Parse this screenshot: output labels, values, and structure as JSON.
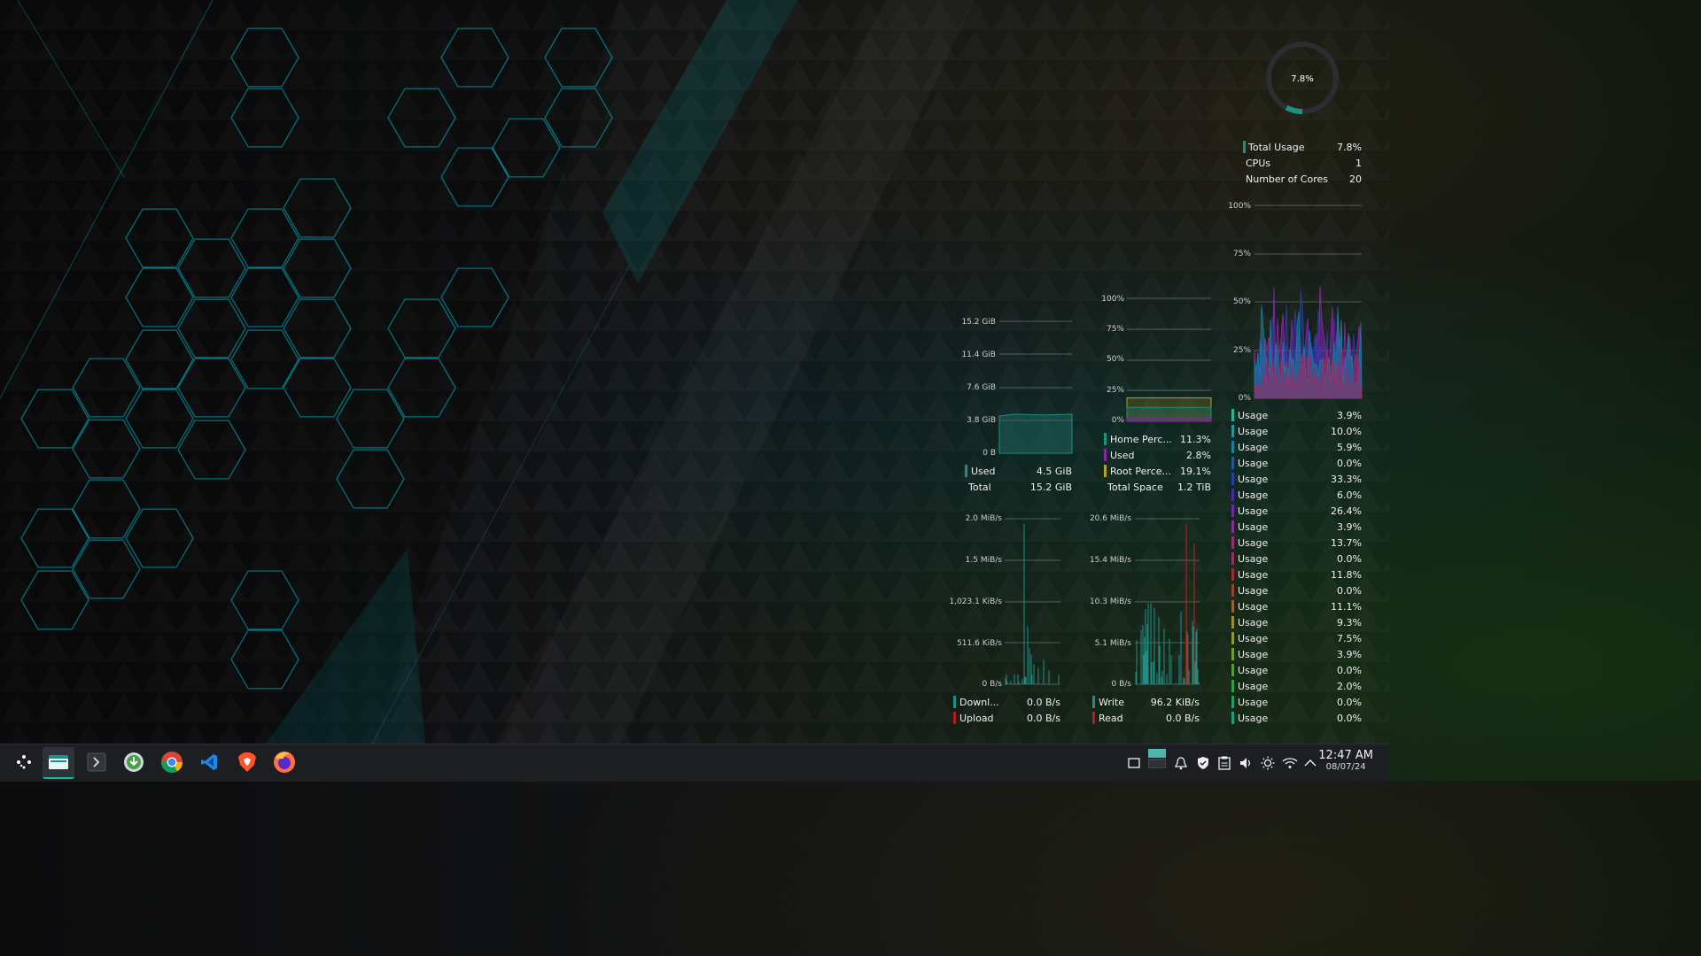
{
  "cpu_widget": {
    "gauge_value": "7.8%",
    "gauge_fraction": 0.078,
    "rows": [
      {
        "label": "Total Usage",
        "value": "7.8%"
      },
      {
        "label": "CPUs",
        "value": "1"
      },
      {
        "label": "Number of Cores",
        "value": "20"
      }
    ],
    "axis": [
      "100%",
      "75%",
      "50%",
      "25%",
      "0%"
    ]
  },
  "cores": {
    "label": "Usage",
    "values": [
      "3.9%",
      "10.0%",
      "5.9%",
      "0.0%",
      "33.3%",
      "6.0%",
      "26.4%",
      "3.9%",
      "13.7%",
      "0.0%",
      "11.8%",
      "0.0%",
      "11.1%",
      "9.3%",
      "7.5%",
      "3.9%",
      "0.0%",
      "2.0%",
      "0.0%",
      "0.0%"
    ],
    "colors": [
      "#1abc9c",
      "#1a9c9c",
      "#1a7fa0",
      "#1a5aa0",
      "#2a3aa8",
      "#4a2aa8",
      "#6a2aa8",
      "#8a2a9c",
      "#9c2a80",
      "#a02a60",
      "#a02a3a",
      "#a0402a",
      "#a0602a",
      "#a08a2a",
      "#909a2a",
      "#70a02a",
      "#50a02a",
      "#30a040",
      "#20a060",
      "#1aa080"
    ]
  },
  "memory_widget": {
    "axis": [
      "15.2 GiB",
      "11.4 GiB",
      "7.6 GiB",
      "3.8 GiB",
      "0 B"
    ],
    "rows": [
      {
        "label": "Used",
        "value": "4.5 GiB"
      },
      {
        "label": "Total",
        "value": "15.2 GiB"
      }
    ],
    "used_fraction": 0.296
  },
  "disk_widget": {
    "axis": [
      "100%",
      "75%",
      "50%",
      "25%",
      "0%"
    ],
    "rows": [
      {
        "label": "Home Perc...",
        "value": "11.3%"
      },
      {
        "label": "Used",
        "value": "2.8%"
      },
      {
        "label": "Root Perce...",
        "value": "19.1%"
      },
      {
        "label": "Total Space",
        "value": "1.2 TiB"
      }
    ]
  },
  "network_widget": {
    "axis": [
      "2.0 MiB/s",
      "1.5 MiB/s",
      "1,023.1 KiB/s",
      "511.6 KiB/s",
      "0 B/s"
    ],
    "rows": [
      {
        "label": "Downl...",
        "value": "0.0 B/s"
      },
      {
        "label": "Upload",
        "value": "0.0 B/s"
      }
    ]
  },
  "diskio_widget": {
    "axis": [
      "20.6 MiB/s",
      "15.4 MiB/s",
      "10.3 MiB/s",
      "5.1 MiB/s",
      "0 B/s"
    ],
    "rows": [
      {
        "label": "Write",
        "value": "96.2 KiB/s"
      },
      {
        "label": "Read",
        "value": "0.0 B/s"
      }
    ]
  },
  "taskbar": {
    "apps": [
      "app-launcher-icon",
      "dolphin-file-manager-icon",
      "konsole-terminal-icon",
      "download-manager-icon",
      "chrome-icon",
      "vscode-icon",
      "brave-icon",
      "firefox-icon"
    ],
    "tray": [
      "show-desktop-icon",
      "pager-icon",
      "notifications-icon",
      "shield-icon",
      "clipboard-icon",
      "volume-icon",
      "brightness-icon",
      "wifi-icon",
      "expand-tray-icon"
    ],
    "time": "12:47 AM",
    "date": "08/07/24"
  },
  "colors": {
    "accent": "#1abc9c",
    "memory": "#1f8f86",
    "disk_home": "#1f8f86",
    "disk_used": "#8e24aa",
    "disk_root": "#b5a21a",
    "download": "#1f8f86",
    "upload": "#b71c1c",
    "write": "#1f8f86",
    "read": "#b71c1c"
  }
}
